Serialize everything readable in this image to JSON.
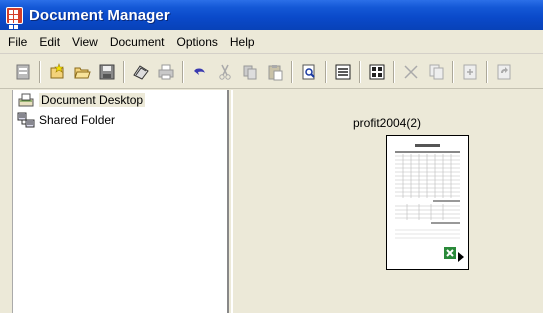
{
  "window": {
    "title": "Document Manager"
  },
  "menu": [
    "File",
    "Edit",
    "View",
    "Document",
    "Options",
    "Help"
  ],
  "toolbar": {
    "buttons": [
      "properties-icon",
      "new-icon",
      "open-folder-icon",
      "save-icon",
      "scan-icon",
      "print-icon",
      "undo-icon",
      "cut-icon",
      "copy-icon",
      "paste-icon",
      "preview-icon",
      "details-view-icon",
      "thumbnail-view-icon",
      "delete-icon",
      "copy-page-icon",
      "insert-page-icon",
      "rotate-icon"
    ]
  },
  "tree": {
    "items": [
      {
        "label": "Document Desktop",
        "icon": "desktop-icon",
        "selected": true
      },
      {
        "label": "Shared Folder",
        "icon": "shared-folder-icon",
        "selected": false
      }
    ]
  },
  "document": {
    "name": "profit2004(2)",
    "type_icon": "excel-icon"
  },
  "colors": {
    "titlebar": "#0a49c9",
    "face": "#ece9d8",
    "accent_red": "#d43f2a"
  }
}
